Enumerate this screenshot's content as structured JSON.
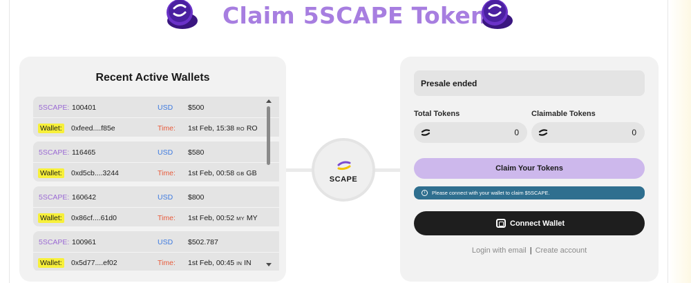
{
  "header": {
    "title": "Claim 5SCAPE Token"
  },
  "recent_wallets": {
    "title": "Recent Active Wallets",
    "labels": {
      "token": "5SCAPE:",
      "usd": "USD",
      "wallet": "Wallet:",
      "time": "Time:"
    },
    "items": [
      {
        "amount": "100401",
        "usd": "$500",
        "wallet": "0xfeed....f85e",
        "time": "1st Feb, 15:38",
        "cc_small": "RO",
        "cc": "RO"
      },
      {
        "amount": "116465",
        "usd": "$580",
        "wallet": "0xd5cb....3244",
        "time": "1st Feb, 00:58",
        "cc_small": "GB",
        "cc": "GB"
      },
      {
        "amount": "160642",
        "usd": "$800",
        "wallet": "0x86cf....61d0",
        "time": "1st Feb, 00:52",
        "cc_small": "MY",
        "cc": "MY"
      },
      {
        "amount": "100961",
        "usd": "$502.787",
        "wallet": "0x5d77....ef02",
        "time": "1st Feb, 00:45",
        "cc_small": "IN",
        "cc": "IN"
      }
    ]
  },
  "center_badge": {
    "text": "SCAPE"
  },
  "claim_panel": {
    "status": "Presale ended",
    "total_tokens_label": "Total Tokens",
    "claimable_tokens_label": "Claimable Tokens",
    "total_tokens_value": "0",
    "claimable_tokens_value": "0",
    "claim_button": "Claim Your Tokens",
    "info_message": "Please connect with your wallet to claim $5SCAPE.",
    "connect_button": "Connect Wallet",
    "login_link": "Login with email",
    "separator": "|",
    "create_link": "Create account"
  },
  "colors": {
    "accent_purple": "#a77ee0",
    "claim_button": "#cdb8ec",
    "info_bar": "#2f6f8f",
    "connect_button": "#1e1e1e",
    "wallet_highlight": "#f7f03a"
  }
}
